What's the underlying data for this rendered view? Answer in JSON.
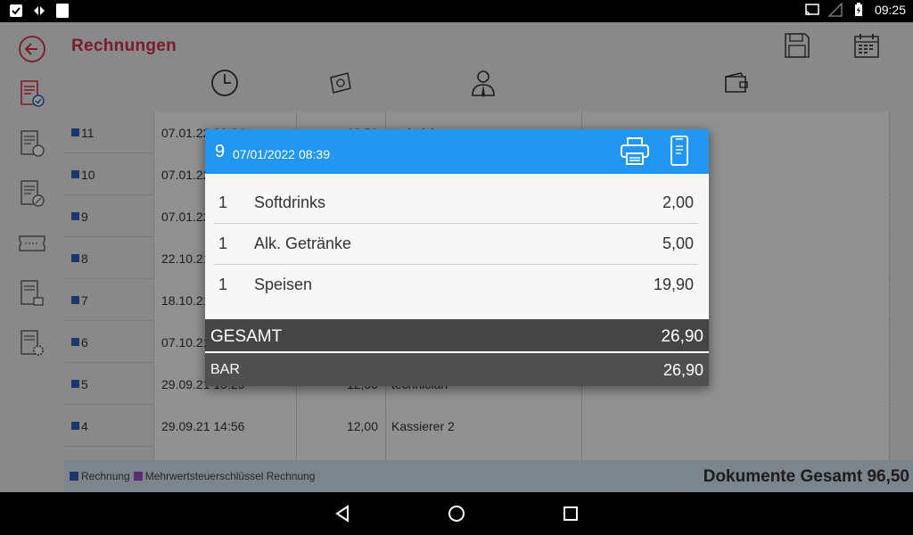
{
  "statusbar": {
    "time": "09:25"
  },
  "header": {
    "title": "Rechnungen"
  },
  "rows": [
    {
      "id": "11",
      "date": "07.01.22 09:04",
      "amount": "12,50",
      "user": "technician"
    },
    {
      "id": "10",
      "date": "07.01.22",
      "amount": "",
      "user": ""
    },
    {
      "id": "9",
      "date": "07.01.22",
      "amount": "",
      "user": ""
    },
    {
      "id": "8",
      "date": "22.10.21",
      "amount": "",
      "user": ""
    },
    {
      "id": "7",
      "date": "18.10.21",
      "amount": "",
      "user": ""
    },
    {
      "id": "6",
      "date": "07.10.21",
      "amount": "",
      "user": ""
    },
    {
      "id": "5",
      "date": "29.09.21 15:29",
      "amount": "12,00",
      "user": "technician"
    },
    {
      "id": "4",
      "date": "29.09.21 14:56",
      "amount": "12,00",
      "user": "Kassierer 2"
    },
    {
      "id": "",
      "date": "",
      "amount": "",
      "user": ""
    }
  ],
  "legend": {
    "items": [
      {
        "label": "Rechnung",
        "color": "#2f5fb8"
      },
      {
        "label": "Mehrwertsteuerschlüssel Rechnung",
        "color": "#9c4fc4"
      }
    ],
    "total": "Dokumente Gesamt 96,50"
  },
  "dialog": {
    "number": "9",
    "datetime": "07/01/2022 08:39",
    "items": [
      {
        "qty": "1",
        "name": "Softdrinks",
        "price": "2,00"
      },
      {
        "qty": "1",
        "name": "Alk. Getränke",
        "price": "5,00"
      },
      {
        "qty": "1",
        "name": "Speisen",
        "price": "19,90"
      }
    ],
    "total_label": "GESAMT",
    "total_value": "26,90",
    "payment_label": "BAR",
    "payment_value": "26,90"
  },
  "colors": {
    "accent": "#2196f3",
    "title": "#d0314a",
    "dark": "#454545"
  },
  "icons": {
    "header": [
      "save-icon",
      "calendar-icon"
    ],
    "columns": [
      "clock-icon",
      "money-icon",
      "user-icon",
      "wallet-icon"
    ],
    "sidebar": [
      "back-icon",
      "invoice-check-icon",
      "invoice-refresh-icon",
      "invoice-percent-icon",
      "ticket-icon",
      "invoice-lock-icon",
      "invoice-settings-icon"
    ]
  }
}
